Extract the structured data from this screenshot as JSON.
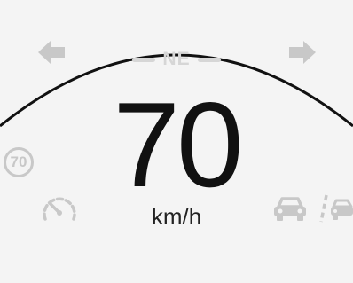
{
  "cluster": {
    "heading": "NE",
    "speed": "70",
    "unit": "km/h",
    "speed_limit": "70"
  },
  "icons": {
    "turn_left": "arrow-left-icon",
    "turn_right": "arrow-right-icon",
    "cruise": "speedometer-gauge-icon",
    "front_car": "front-car-icon",
    "lane_assist": "lane-departure-car-icon"
  },
  "colors": {
    "background": "#f4f4f4",
    "dial_arc": "#111111",
    "inactive_indicator": "#c8c8c8",
    "speed_text": "#111111"
  }
}
